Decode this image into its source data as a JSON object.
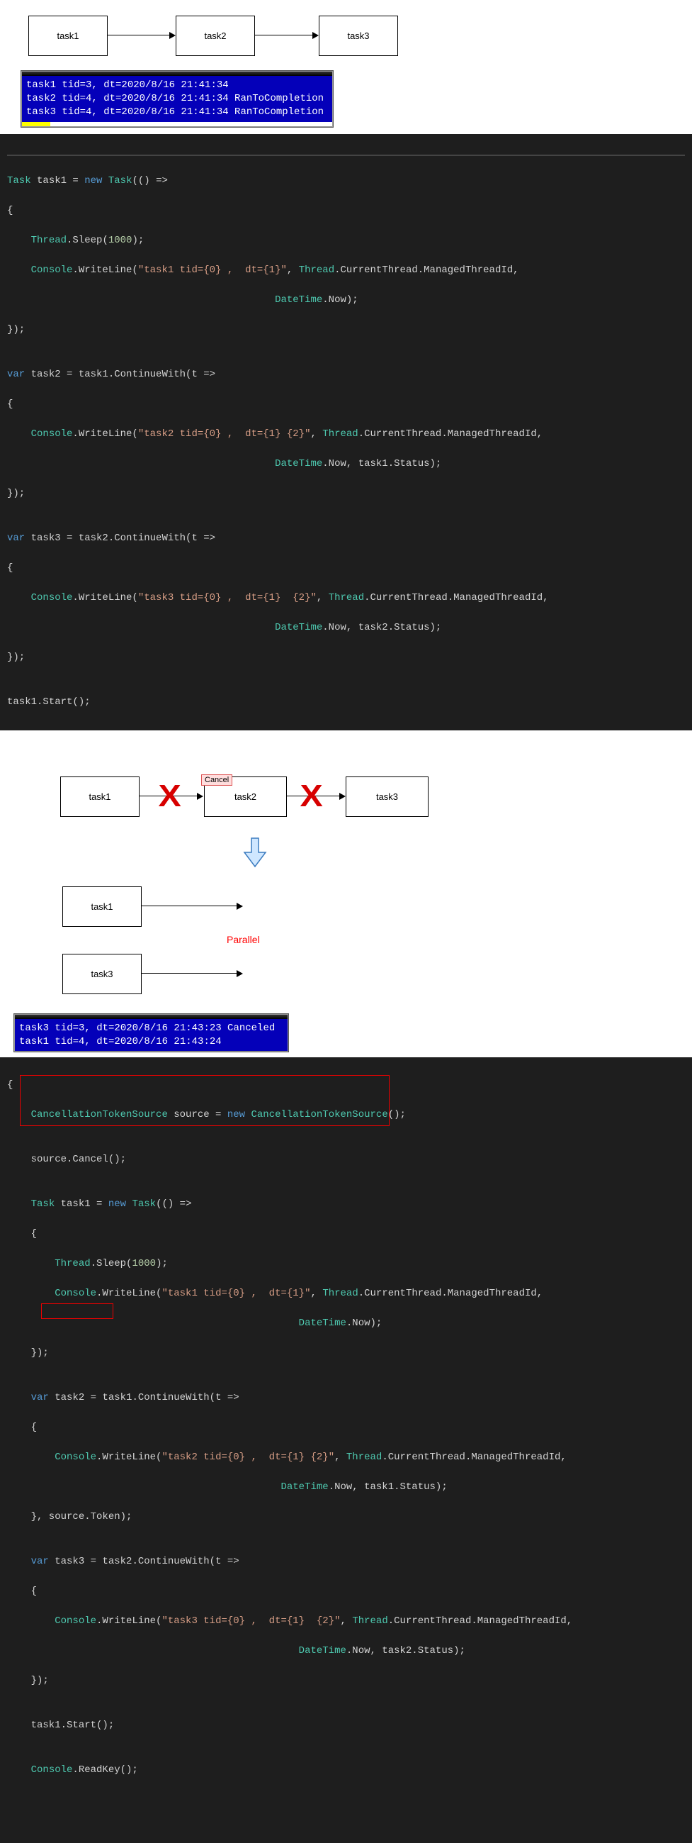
{
  "diagram1": {
    "box1": "task1",
    "box2": "task2",
    "box3": "task3"
  },
  "console1": {
    "l1": "task1 tid=3,  dt=2020/8/16 21:41:34",
    "l2": "task2 tid=4,  dt=2020/8/16 21:41:34 RanToCompletion",
    "l3": "task3 tid=4,  dt=2020/8/16 21:41:34  RanToCompletion"
  },
  "code1": {
    "l1_a": "Task",
    "l1_b": " task1 = ",
    "l1_c": "new",
    "l1_d": " ",
    "l1_e": "Task",
    "l1_f": "(() =>",
    "l2": "{",
    "l3_a": "    ",
    "l3_b": "Thread",
    "l3_c": ".Sleep(",
    "l3_d": "1000",
    "l3_e": ");",
    "l4_a": "    ",
    "l4_b": "Console",
    "l4_c": ".WriteLine(",
    "l4_d": "\"task1 tid={0} ,  dt={1}\"",
    "l4_e": ", ",
    "l4_f": "Thread",
    "l4_g": ".CurrentThread.ManagedThreadId,",
    "l5_a": "                                             ",
    "l5_b": "DateTime",
    "l5_c": ".Now);",
    "l6": "});",
    "l7": "",
    "l8_a": "var",
    "l8_b": " task2 = task1.ContinueWith(t =>",
    "l9": "{",
    "l10_a": "    ",
    "l10_b": "Console",
    "l10_c": ".WriteLine(",
    "l10_d": "\"task2 tid={0} ,  dt={1} {2}\"",
    "l10_e": ", ",
    "l10_f": "Thread",
    "l10_g": ".CurrentThread.ManagedThreadId,",
    "l11_a": "                                             ",
    "l11_b": "DateTime",
    "l11_c": ".Now, task1.Status);",
    "l12": "});",
    "l13": "",
    "l14_a": "var",
    "l14_b": " task3 = task2.ContinueWith(t =>",
    "l15": "{",
    "l16_a": "    ",
    "l16_b": "Console",
    "l16_c": ".WriteLine(",
    "l16_d": "\"task3 tid={0} ,  dt={1}  {2}\"",
    "l16_e": ", ",
    "l16_f": "Thread",
    "l16_g": ".CurrentThread.ManagedThreadId,",
    "l17_a": "                                             ",
    "l17_b": "DateTime",
    "l17_c": ".Now, task2.Status);",
    "l18": "});",
    "l19": "",
    "l20": "task1.Start();"
  },
  "diagram2": {
    "box1": "task1",
    "box2": "task2",
    "box3": "task3",
    "cancel": "Cancel",
    "boxA": "task1",
    "boxB": "task3",
    "parallel": "Parallel"
  },
  "console2": {
    "l1": "task3 tid=3,  dt=2020/8/16 21:43:23  Canceled",
    "l2": "task1 tid=4,  dt=2020/8/16 21:43:24"
  },
  "code2": {
    "l0": "{",
    "l1_a": "    ",
    "l1_b": "CancellationTokenSource",
    "l1_c": " source = ",
    "l1_d": "new",
    "l1_e": " ",
    "l1_f": "CancellationTokenSource",
    "l1_g": "();",
    "l2": "",
    "l3": "    source.Cancel();",
    "l4": "",
    "l5_a": "    ",
    "l5_b": "Task",
    "l5_c": " task1 = ",
    "l5_d": "new",
    "l5_e": " ",
    "l5_f": "Task",
    "l5_g": "(() =>",
    "l6": "    {",
    "l7_a": "        ",
    "l7_b": "Thread",
    "l7_c": ".Sleep(",
    "l7_d": "1000",
    "l7_e": ");",
    "l8_a": "        ",
    "l8_b": "Console",
    "l8_c": ".WriteLine(",
    "l8_d": "\"task1 tid={0} ,  dt={1}\"",
    "l8_e": ", ",
    "l8_f": "Thread",
    "l8_g": ".CurrentThread.ManagedThreadId,",
    "l9_a": "                                                 ",
    "l9_b": "DateTime",
    "l9_c": ".Now);",
    "l10": "    });",
    "l11": "",
    "l12_a": "    ",
    "l12_b": "var",
    "l12_c": " task2 = task1.ContinueWith(t =>",
    "l13": "    {",
    "l14_a": "        ",
    "l14_b": "Console",
    "l14_c": ".WriteLine(",
    "l14_d": "\"task2 tid={0} ,  dt={1} {2}\"",
    "l14_e": ", ",
    "l14_f": "Thread",
    "l14_g": ".CurrentThread.ManagedThreadId,",
    "l15_a": "                                              ",
    "l15_b": "DateTime",
    "l15_c": ".Now, task1.Status);",
    "l16": "    }, source.Token);",
    "l17": "",
    "l18_a": "    ",
    "l18_b": "var",
    "l18_c": " task3 = task2.ContinueWith(t =>",
    "l19": "    {",
    "l20_a": "        ",
    "l20_b": "Console",
    "l20_c": ".WriteLine(",
    "l20_d": "\"task3 tid={0} ,  dt={1}  {2}\"",
    "l20_e": ", ",
    "l20_f": "Thread",
    "l20_g": ".CurrentThread.ManagedThreadId,",
    "l21_a": "                                                 ",
    "l21_b": "DateTime",
    "l21_c": ".Now, task2.Status);",
    "l22": "    });",
    "l23": "",
    "l24": "    task1.Start();",
    "l25": "",
    "l26_a": "    ",
    "l26_b": "Console",
    "l26_c": ".ReadKey();"
  }
}
